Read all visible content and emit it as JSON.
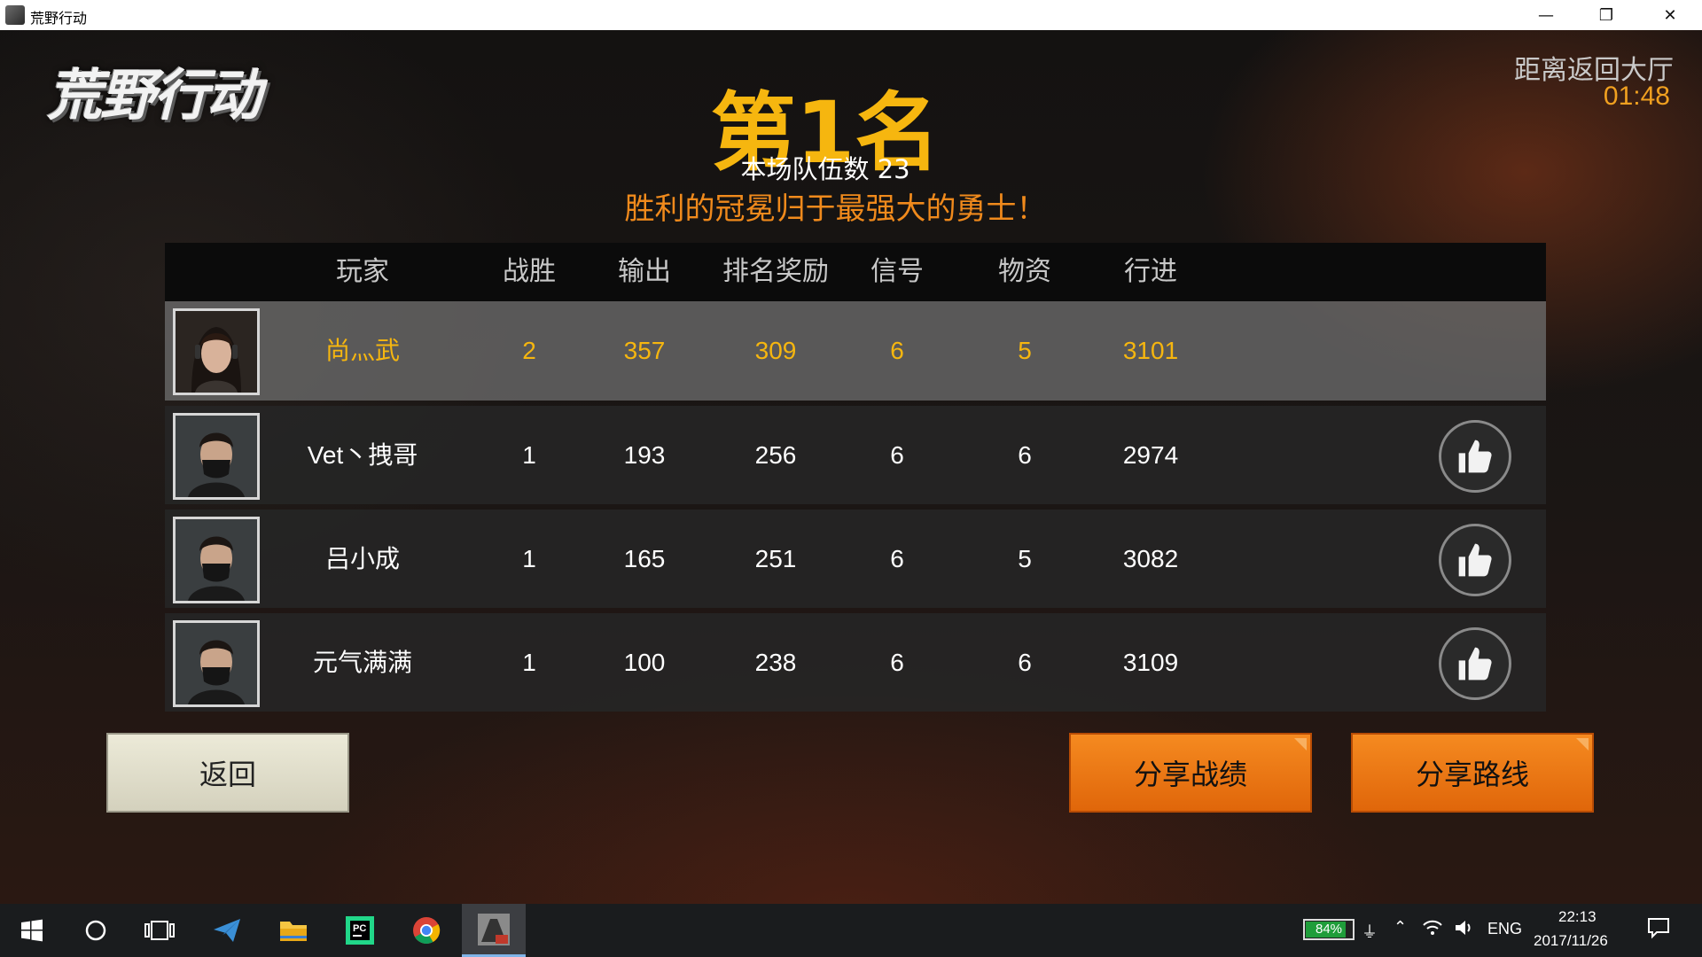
{
  "window": {
    "title": "荒野行动",
    "minimize_glyph": "—",
    "restore_glyph": "❐",
    "close_glyph": "✕"
  },
  "game": {
    "logo_text": "荒野行动",
    "countdown_label": "距离返回大厅",
    "countdown_time": "01:48",
    "rank_title": "第1名",
    "team_count": "本场队伍数 23",
    "slogan": "胜利的冠冕归于最强大的勇士！",
    "columns": [
      "玩家",
      "战胜",
      "输出",
      "排名奖励",
      "信号",
      "物资",
      "行进"
    ],
    "players": [
      {
        "name": "尚灬武",
        "kills": "2",
        "damage": "357",
        "rank_reward": "309",
        "signal": "6",
        "supplies": "5",
        "travel": "3101",
        "highlight": true,
        "avatar": "female-avatar-icon"
      },
      {
        "name": "Vet丶拽哥",
        "kills": "1",
        "damage": "193",
        "rank_reward": "256",
        "signal": "6",
        "supplies": "6",
        "travel": "2974",
        "highlight": false,
        "avatar": "masked-male-avatar-icon"
      },
      {
        "name": "吕小成",
        "kills": "1",
        "damage": "165",
        "rank_reward": "251",
        "signal": "6",
        "supplies": "5",
        "travel": "3082",
        "highlight": false,
        "avatar": "masked-male-avatar-icon"
      },
      {
        "name": "元气满满",
        "kills": "1",
        "damage": "100",
        "rank_reward": "238",
        "signal": "6",
        "supplies": "6",
        "travel": "3109",
        "highlight": false,
        "avatar": "masked-male-avatar-icon"
      }
    ],
    "back_button": "返回",
    "share_stats_button": "分享战绩",
    "share_route_button": "分享路线",
    "colors": {
      "gold": "#f6b60f",
      "orange": "#f08a1c",
      "button_orange": "#f58a20"
    }
  },
  "taskbar": {
    "battery_percent": "84%",
    "battery_level": 0.84,
    "language": "ENG",
    "time": "22:13",
    "date": "2017/11/26",
    "icons": [
      "windows-start-icon",
      "cortana-circle-icon",
      "task-view-icon",
      "paper-plane-icon",
      "file-explorer-icon",
      "pycharm-icon",
      "chrome-icon",
      "game-app-icon"
    ]
  }
}
